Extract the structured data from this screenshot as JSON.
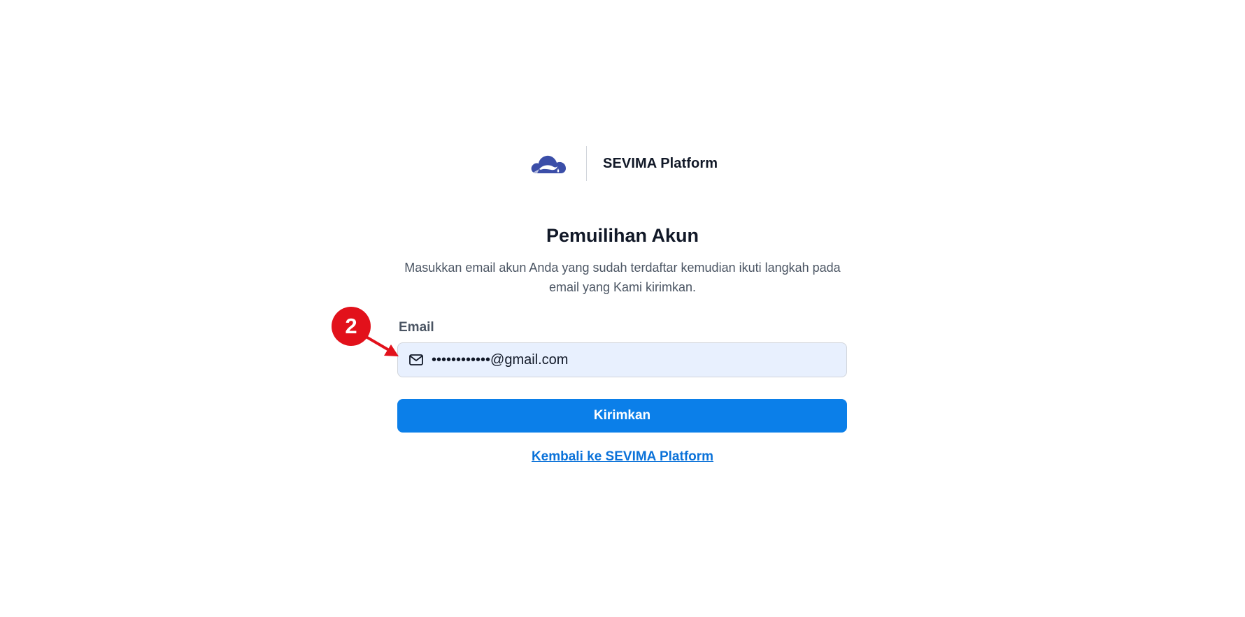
{
  "brand": {
    "name": "SEVIMA Platform",
    "logo_icon": "cloud-logo-icon",
    "logo_color": "#3b4ea8"
  },
  "page": {
    "title": "Pemuilihan Akun",
    "subtitle": "Masukkan email akun Anda yang sudah terdaftar kemudian ikuti langkah pada email yang Kami kirimkan."
  },
  "form": {
    "email_label": "Email",
    "email_icon": "mail-icon",
    "email_value": "••••••••••••@gmail.com",
    "email_field_bg": "#e8f0fe",
    "submit_label": "Kirimkan",
    "submit_color": "#0b7fe9"
  },
  "links": {
    "back_label": "Kembali ke SEVIMA Platform",
    "back_color": "#0b72d9"
  },
  "annotation": {
    "step_number": "2",
    "color": "#e2111b"
  }
}
